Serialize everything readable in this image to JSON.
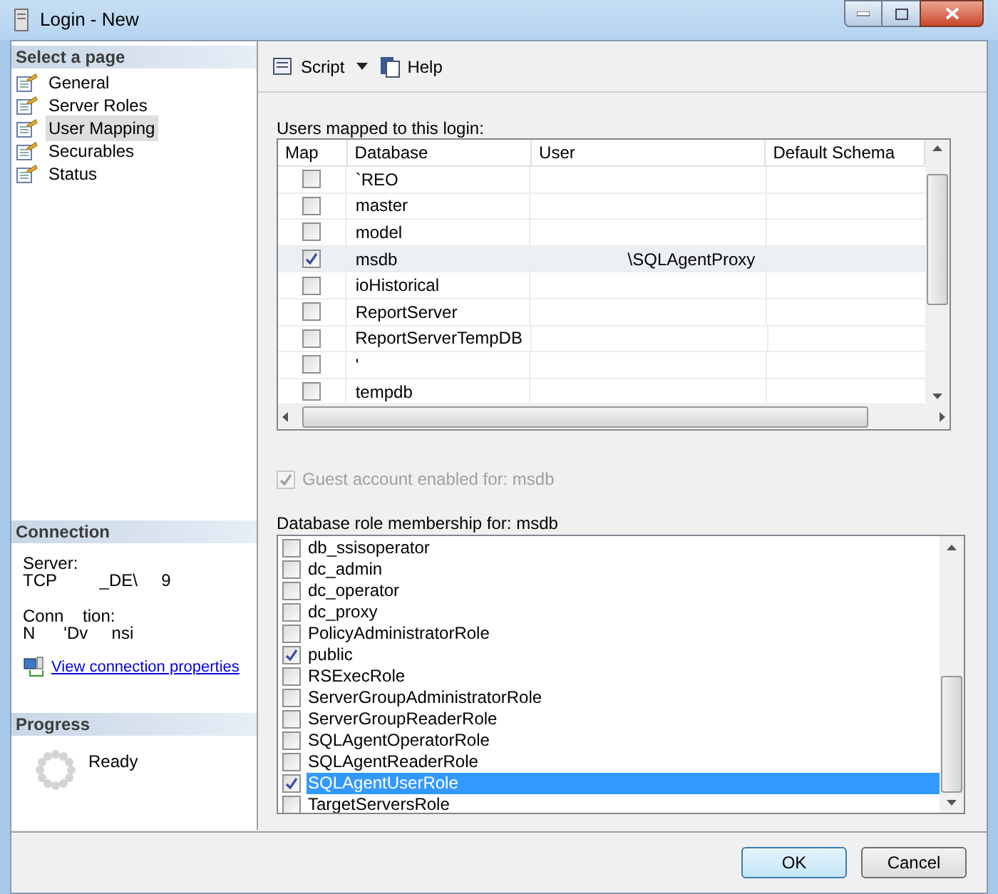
{
  "window": {
    "title": "Login - New"
  },
  "sidebar": {
    "header": "Select a page",
    "items": [
      {
        "label": "General",
        "selected": false
      },
      {
        "label": "Server Roles",
        "selected": false
      },
      {
        "label": "User Mapping",
        "selected": true
      },
      {
        "label": "Securables",
        "selected": false
      },
      {
        "label": "Status",
        "selected": false
      }
    ]
  },
  "connection": {
    "header": "Connection",
    "server_label": "Server:",
    "server_value": "TCP         _DE\\     9",
    "connection_label": "Conn    tion:",
    "connection_value": "N      'Dv     nsi",
    "link": "View connection properties"
  },
  "progress": {
    "header": "Progress",
    "status": "Ready"
  },
  "toolbar": {
    "script": "Script",
    "help": "Help"
  },
  "users_label": "Users mapped to this login:",
  "mapping_table": {
    "columns": [
      "Map",
      "Database",
      "User",
      "Default Schema"
    ],
    "rows": [
      {
        "checked": false,
        "selected": false,
        "database": "`REO",
        "user": "",
        "schema": ""
      },
      {
        "checked": false,
        "selected": false,
        "database": "master",
        "user": "",
        "schema": ""
      },
      {
        "checked": false,
        "selected": false,
        "database": "model",
        "user": "",
        "schema": ""
      },
      {
        "checked": true,
        "selected": true,
        "database": "msdb",
        "user": "\\SQLAgentProxy",
        "schema": ""
      },
      {
        "checked": false,
        "selected": false,
        "database": "ioHistorical",
        "user": "",
        "schema": ""
      },
      {
        "checked": false,
        "selected": false,
        "database": "ReportServer",
        "user": "",
        "schema": ""
      },
      {
        "checked": false,
        "selected": false,
        "database": "ReportServerTempDB",
        "user": "",
        "schema": ""
      },
      {
        "checked": false,
        "selected": false,
        "database": "'",
        "user": "",
        "schema": ""
      },
      {
        "checked": false,
        "selected": false,
        "database": "tempdb",
        "user": "",
        "schema": ""
      }
    ]
  },
  "guest": {
    "label": "Guest account enabled for: msdb",
    "checked": true,
    "disabled": true
  },
  "roles_label": "Database role membership for: msdb",
  "roles": [
    {
      "label": "db_ssisoperator",
      "checked": false,
      "selected": false
    },
    {
      "label": "dc_admin",
      "checked": false,
      "selected": false
    },
    {
      "label": "dc_operator",
      "checked": false,
      "selected": false
    },
    {
      "label": "dc_proxy",
      "checked": false,
      "selected": false
    },
    {
      "label": "PolicyAdministratorRole",
      "checked": false,
      "selected": false
    },
    {
      "label": "public",
      "checked": true,
      "selected": false
    },
    {
      "label": "RSExecRole",
      "checked": false,
      "selected": false
    },
    {
      "label": "ServerGroupAdministratorRole",
      "checked": false,
      "selected": false
    },
    {
      "label": "ServerGroupReaderRole",
      "checked": false,
      "selected": false
    },
    {
      "label": "SQLAgentOperatorRole",
      "checked": false,
      "selected": false
    },
    {
      "label": "SQLAgentReaderRole",
      "checked": false,
      "selected": false
    },
    {
      "label": "SQLAgentUserRole",
      "checked": true,
      "selected": true
    },
    {
      "label": "TargetServersRole",
      "checked": false,
      "selected": false
    }
  ],
  "buttons": [
    "OK",
    "Cancel"
  ]
}
